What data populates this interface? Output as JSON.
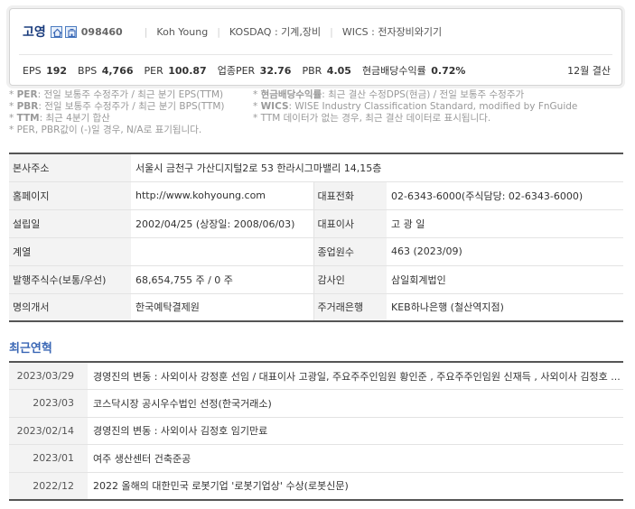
{
  "company": {
    "name": "고영",
    "code": "098460",
    "english_name": "Koh Young",
    "market": "KOSDAQ : 기계,장비",
    "wics": "WICS : 전자장비와기기"
  },
  "icons": [
    "home-icon",
    "company-icon"
  ],
  "stats": [
    {
      "label": "EPS",
      "value": "192"
    },
    {
      "label": "BPS",
      "value": "4,766"
    },
    {
      "label": "PER",
      "value": "100.87"
    },
    {
      "label": "업종PER",
      "value": "32.76"
    },
    {
      "label": "PBR",
      "value": "4.05"
    },
    {
      "label": "현금배당수익률",
      "value": "0.72%"
    }
  ],
  "settlement": "12월 결산",
  "notes": {
    "left": [
      {
        "key": "PER",
        "text": ": 전일 보통주 수정주가 / 최근 분기 EPS(TTM)"
      },
      {
        "key": "PBR",
        "text": ": 전일 보통주 수정주가 / 최근 분기 BPS(TTM)"
      },
      {
        "key": "TTM",
        "text": ": 최근 4분기 합산"
      },
      {
        "key": "",
        "text": "PER, PBR값이 (-)일 경우, N/A로 표기됩니다."
      }
    ],
    "right": [
      {
        "key": "현금배당수익률",
        "text": ": 최근 결산 수정DPS(현금) / 전일 보통주 수정주가"
      },
      {
        "key": "WICS",
        "text": ": WISE Industry Classification Standard, modified by FnGuide"
      },
      {
        "key": "",
        "text": "TTM 데이터가 없는 경우, 최근 결산 데이터로 표시됩니다."
      }
    ]
  },
  "info": {
    "address_label": "본사주소",
    "address": "서울시 금천구 가산디지털2로 53 한라시그마밸리 14,15층",
    "homepage_label": "홈페이지",
    "homepage": "http://www.kohyoung.com",
    "phone_label": "대표전화",
    "phone": "02-6343-6000(주식담당: 02-6343-6000)",
    "founded_label": "설립일",
    "founded": "2002/04/25 (상장일: 2008/06/03)",
    "ceo_label": "대표이사",
    "ceo": "고 광 일",
    "affiliate_label": "계열",
    "affiliate": "",
    "employees_label": "종업원수",
    "employees": "463 (2023/09)",
    "shares_label": "발행주식수(보통/우선)",
    "shares": "68,654,755 주 / 0 주",
    "auditor_label": "감사인",
    "auditor": "삼일회계법인",
    "transfer_label": "명의개서",
    "transfer": "한국예탁결제원",
    "bank_label": "주거래은행",
    "bank": "KEB하나은행 (철산역지점)"
  },
  "history_title": "최근연혁",
  "history": [
    {
      "date": "2023/03/29",
      "text": "경영진의 변동 : 사외이사 강정훈 선임 / 대표이사 고광일, 주요주주인임원 황인준 , 주요주주인임원 신재득 , 사외이사 김정호 ..."
    },
    {
      "date": "2023/03",
      "text": "코스닥시장 공시우수법인 선정(한국거래소)"
    },
    {
      "date": "2023/02/14",
      "text": "경영진의 변동 : 사외이사 김정호 임기만료"
    },
    {
      "date": "2023/01",
      "text": "여주 생산센터 건축준공"
    },
    {
      "date": "2022/12",
      "text": "2022 올해의 대한민국 로봇기업 '로봇기업상' 수상(로봇신문)"
    }
  ]
}
